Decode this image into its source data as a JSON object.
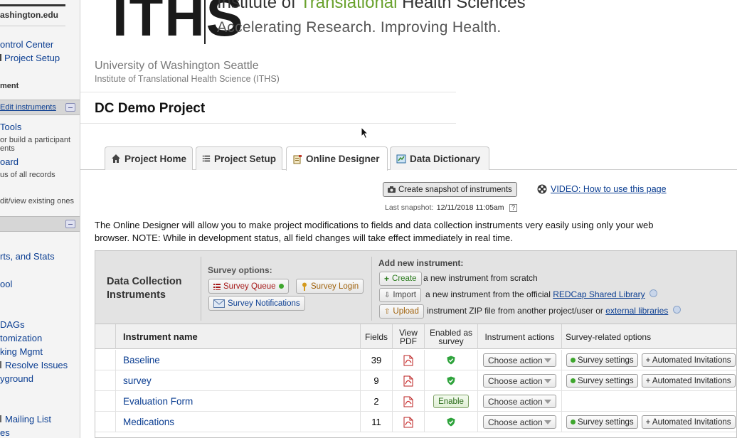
{
  "sidebar": {
    "domain_text": "ashington.edu",
    "links": {
      "control_center": "ontrol Center",
      "project_setup": "Project Setup",
      "edit_instruments": "Edit instruments",
      "tools": "Tools",
      "board": "oard",
      "reports": "rts, and Stats",
      "ool": "ool",
      "dags": "DAGs",
      "customization": "tomization",
      "king_mgmt": "king Mgmt",
      "resolve_issues": "Resolve Issues",
      "playground": "yground",
      "mailing_list": "Mailing List",
      "es": "es"
    },
    "section_ment": "ment",
    "tools_desc1": "or build a participant",
    "tools_desc2": "ents",
    "board_desc": "us of all records",
    "edit_desc": "dit/view existing ones"
  },
  "header": {
    "logo_letters": "ITHS",
    "logo_line1_a": "Institute of ",
    "logo_line1_b": "Translational",
    "logo_line1_c": " Health Sciences",
    "logo_line2": "Accelerating Research. Improving Health.",
    "university": "University of Washington Seattle",
    "institute": "Institute of Translational Health Science (ITHS)",
    "project_title": "DC Demo Project"
  },
  "tabs": [
    {
      "label": "Project Home"
    },
    {
      "label": "Project Setup"
    },
    {
      "label": "Online Designer"
    },
    {
      "label": "Data Dictionary"
    }
  ],
  "snapshot": {
    "button": "Create snapshot of instruments",
    "last_label": "Last snapshot:",
    "last_value": "12/11/2018 11:05am",
    "help": "?"
  },
  "video_link": "VIDEO: How to use this page",
  "description": "The Online Designer will allow you to make project modifications to fields and data collection instruments very easily using only your web browser. NOTE: While in development status, all field changes will take effect immediately in real time.",
  "panel": {
    "title_line1": "Data Collection",
    "title_line2": "Instruments",
    "survey_options_label": "Survey options:",
    "survey_queue": "Survey Queue",
    "survey_login": "Survey Login",
    "survey_notifications": "Survey Notifications",
    "add_new_label": "Add new instrument:",
    "create_btn": "Create",
    "create_text": "a new instrument from scratch",
    "import_btn": "Import",
    "import_text": "a new instrument from the official",
    "import_link": "REDCap Shared Library",
    "upload_btn": "Upload",
    "upload_text": "instrument ZIP file from another project/user or",
    "upload_link": "external libraries"
  },
  "table": {
    "headers": {
      "name": "Instrument name",
      "fields": "Fields",
      "view_pdf": "View PDF",
      "enabled": "Enabled as survey",
      "actions": "Instrument actions",
      "survey_opts": "Survey-related options"
    },
    "rows": [
      {
        "name": "Baseline",
        "fields": "39",
        "enabled": true,
        "action": "Choose action",
        "settings": "Survey settings",
        "auto": "+ Automated Invitations"
      },
      {
        "name": "survey",
        "fields": "9",
        "enabled": true,
        "action": "Choose action",
        "settings": "Survey settings",
        "auto": "+ Automated Invitations"
      },
      {
        "name": "Evaluation Form",
        "fields": "2",
        "enabled": false,
        "enable_label": "Enable",
        "action": "Choose action"
      },
      {
        "name": "Medications",
        "fields": "11",
        "enabled": true,
        "action": "Choose action",
        "settings": "Survey settings",
        "auto": "+ Automated Invitations"
      }
    ]
  },
  "colors": {
    "link": "#0a3d91",
    "logo_green": "#6aa22e",
    "panel_header": "#e3e3e3",
    "sidebar_bg": "#f4f4f4"
  }
}
